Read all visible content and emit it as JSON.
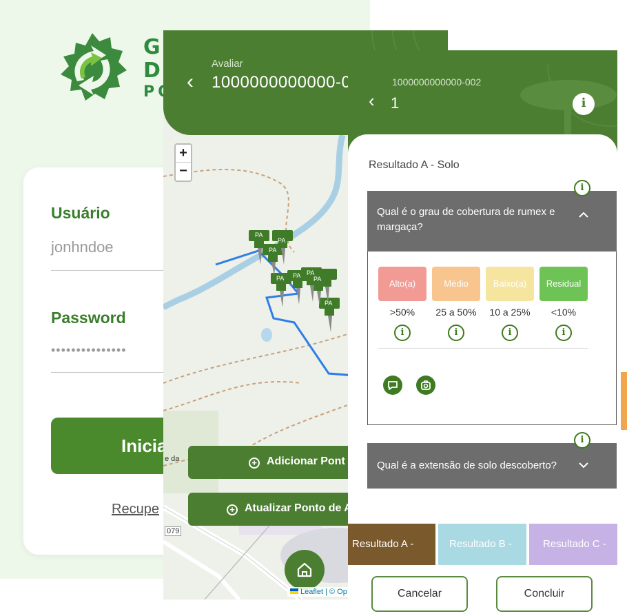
{
  "login": {
    "logo_lines": [
      "G",
      "D",
      "PO"
    ],
    "username_label": "Usuário",
    "username_value": "jonhndoe",
    "password_label": "Password",
    "password_value": "•••••••••••••••",
    "login_button": "Inicia",
    "recover_link": "Recupe"
  },
  "map_screen": {
    "header_small": "Avaliar",
    "header_title": "1000000000000-0",
    "zoom_in": "+",
    "zoom_out": "−",
    "marker_label": "PA",
    "add_point_button": "Adicionar Pont",
    "update_point_button": "Atualizar Ponto de A",
    "road_partial_label": "e da",
    "road_number": "079",
    "attribution": "Leaflet | © Op"
  },
  "question_screen": {
    "header_small": "1000000000000-002",
    "header_title": "1",
    "section_title": "Resultado A - Solo",
    "question1": "Qual é o grau de cobertura de rumex e margaça?",
    "question2": "Qual é a extensão de solo descoberto?",
    "options": [
      {
        "label": "Alto(a)",
        "range": ">50%",
        "color": "#f19b94"
      },
      {
        "label": "Médio",
        "range": "25 a 50%",
        "color": "#f7c58d"
      },
      {
        "label": "Baixo(a)",
        "range": "10 a 25%",
        "color": "#f6e59e"
      },
      {
        "label": "Residual",
        "range": "<10%",
        "color": "#6ec356"
      }
    ],
    "tabs": [
      {
        "label": "Resultado A -",
        "color": "#7a5a2c"
      },
      {
        "label": "Resultado B -",
        "color": "#a9d9e3"
      },
      {
        "label": "Resultado C -",
        "color": "#c7b2e6"
      }
    ],
    "cancel_button": "Cancelar",
    "confirm_button": "Concluir",
    "info_glyph": "i"
  },
  "colors": {
    "brand_green": "#4c7e32",
    "header_green": "#4c7e32",
    "question_header_gray": "#6d6d6d"
  }
}
